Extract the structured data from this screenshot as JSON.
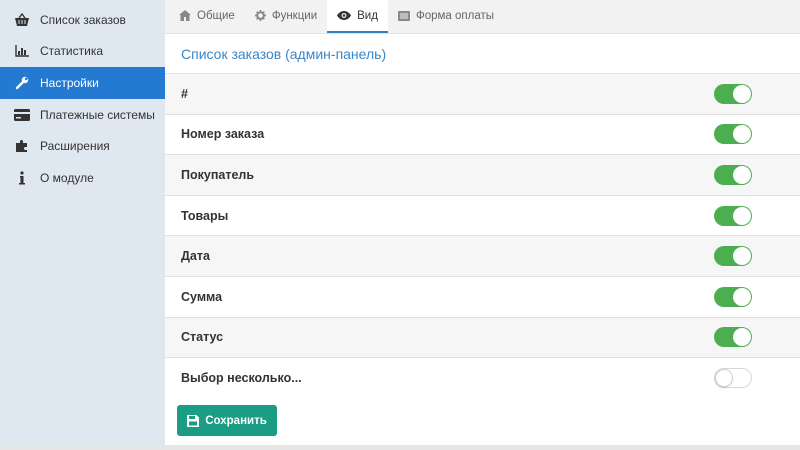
{
  "sidebar": {
    "items": [
      {
        "label": "Список заказов",
        "icon": "basket-icon"
      },
      {
        "label": "Статистика",
        "icon": "bar-chart-icon"
      },
      {
        "label": "Настройки",
        "icon": "wrench-icon",
        "active": true
      },
      {
        "label": "Платежные системы",
        "icon": "credit-card-icon"
      },
      {
        "label": "Расширения",
        "icon": "puzzle-icon"
      },
      {
        "label": "О модуле",
        "icon": "info-icon"
      }
    ]
  },
  "tabs": [
    {
      "label": "Общие",
      "icon": "home-icon"
    },
    {
      "label": "Функции",
      "icon": "gear-icon"
    },
    {
      "label": "Вид",
      "icon": "eye-icon",
      "active": true
    },
    {
      "label": "Форма оплаты",
      "icon": "list-icon"
    }
  ],
  "section": {
    "title": "Список заказов (админ-панель)"
  },
  "rows": [
    {
      "label": "#",
      "enabled": true
    },
    {
      "label": "Номер заказа",
      "enabled": true
    },
    {
      "label": "Покупатель",
      "enabled": true
    },
    {
      "label": "Товары",
      "enabled": true
    },
    {
      "label": "Дата",
      "enabled": true
    },
    {
      "label": "Сумма",
      "enabled": true
    },
    {
      "label": "Статус",
      "enabled": true
    },
    {
      "label": "Выбор несколько...",
      "enabled": false
    }
  ],
  "save_button": {
    "label": "Сохранить",
    "icon": "floppy-icon"
  },
  "colors": {
    "sidebar_bg": "#dfe7f1",
    "active_item": "#2479d1",
    "toggle_on": "#4cae4f",
    "save_button": "#1b9c85",
    "section_title": "#3a86c8"
  }
}
